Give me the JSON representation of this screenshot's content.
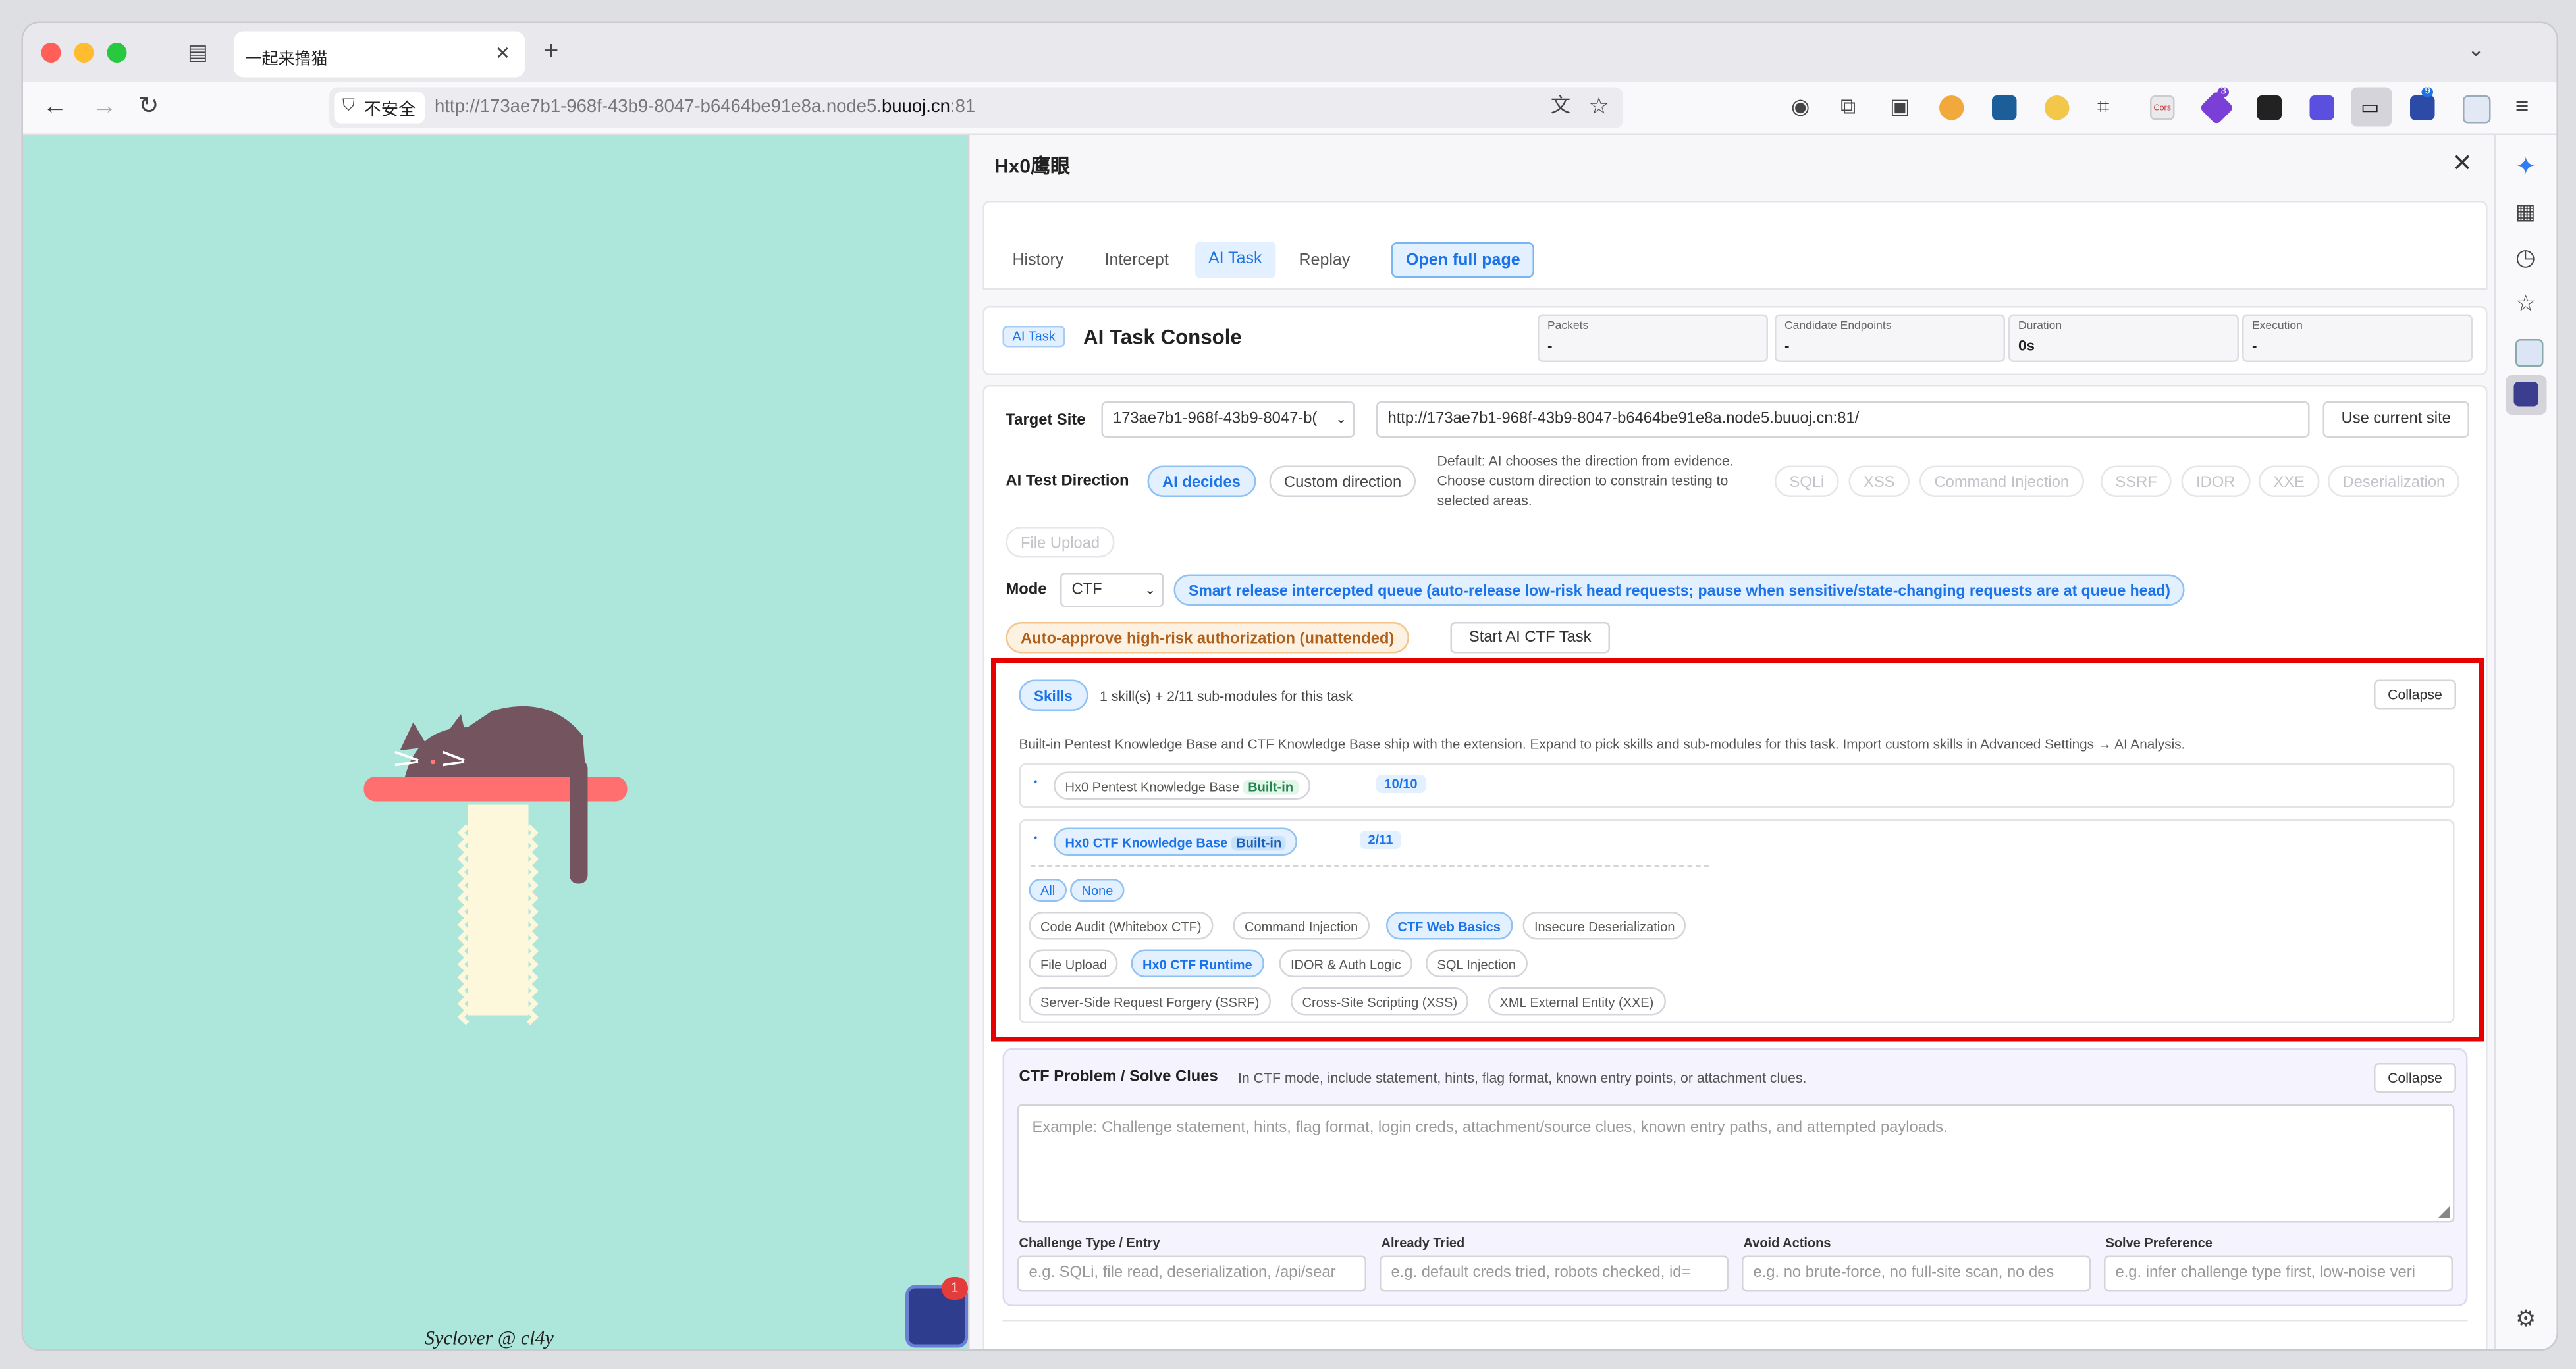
{
  "browser": {
    "tab_title": "一起来撸猫",
    "security_label": "不安全",
    "url_prefix": "http://173ae7b1-968f-43b9-8047-b6464be91e8a.node5.",
    "url_domain": "buuoj.cn",
    "url_suffix": ":81",
    "ext_badge_1": "3",
    "ext_badge_2": "9",
    "ext_label": "Cors",
    "colors": {
      "traffic_red": "#ff5f57",
      "traffic_yellow": "#febc2e",
      "traffic_green": "#28c840"
    }
  },
  "page": {
    "bg_color": "#ade6da",
    "credit": "Syclover @ cl4y",
    "notification_badge": "1"
  },
  "panel": {
    "title": "Hx0鹰眼",
    "tabs": [
      "History",
      "Intercept",
      "AI Task",
      "Replay"
    ],
    "active_tab": "AI Task",
    "open_full_page": "Open full page",
    "console": {
      "badge": "AI Task",
      "title": "AI Task Console",
      "stats": [
        {
          "label": "Packets",
          "value": "-"
        },
        {
          "label": "Candidate Endpoints",
          "value": "-"
        },
        {
          "label": "Duration",
          "value": "0s"
        },
        {
          "label": "Execution",
          "value": "-"
        }
      ]
    },
    "target": {
      "label": "Target Site",
      "select_value": "173ae7b1-968f-43b9-8047-b(",
      "url": "http://173ae7b1-968f-43b9-8047-b6464be91e8a.node5.buuoj.cn:81/",
      "use_current": "Use current site"
    },
    "direction": {
      "label": "AI Test Direction",
      "ai_decides": "AI decides",
      "custom": "Custom direction",
      "description": "Default: AI chooses the direction from evidence. Choose custom direction to constrain testing to selected areas.",
      "options": [
        "SQLi",
        "XSS",
        "Command Injection",
        "SSRF",
        "IDOR",
        "XXE",
        "Deserialization",
        "File Upload"
      ]
    },
    "mode": {
      "label": "Mode",
      "value": "CTF",
      "smart_release": "Smart release intercepted queue (auto-release low-risk head requests; pause when sensitive/state-changing requests are at queue head)",
      "auto_approve": "Auto-approve high-risk authorization (unattended)",
      "start_button": "Start AI CTF Task"
    },
    "skills": {
      "badge": "Skills",
      "summary": "1 skill(s) + 2/11 sub-modules for this task",
      "collapse": "Collapse",
      "description": "Built-in Pentest Knowledge Base and CTF Knowledge Base ship with the extension. Expand to pick skills and sub-modules for this task. Import custom skills in Advanced Settings → AI Analysis.",
      "kb_pentest": {
        "name": "Hx0 Pentest Knowledge Base",
        "builtin": "Built-in",
        "count": "10/10"
      },
      "kb_ctf": {
        "name": "Hx0 CTF Knowledge Base",
        "builtin": "Built-in",
        "count": "2/11"
      },
      "all": "All",
      "none": "None",
      "modules": [
        {
          "name": "Code Audit (Whitebox CTF)",
          "on": false
        },
        {
          "name": "Command Injection",
          "on": false
        },
        {
          "name": "CTF Web Basics",
          "on": true
        },
        {
          "name": "Insecure Deserialization",
          "on": false
        },
        {
          "name": "File Upload",
          "on": false
        },
        {
          "name": "Hx0 CTF Runtime",
          "on": true
        },
        {
          "name": "IDOR & Auth Logic",
          "on": false
        },
        {
          "name": "SQL Injection",
          "on": false
        },
        {
          "name": "Server-Side Request Forgery (SSRF)",
          "on": false
        },
        {
          "name": "Cross-Site Scripting (XSS)",
          "on": false
        },
        {
          "name": "XML External Entity (XXE)",
          "on": false
        }
      ],
      "highlight_color": "#e60000"
    },
    "ctf": {
      "title": "CTF Problem / Solve Clues",
      "hint": "In CTF mode, include statement, hints, flag format, known entry points, or attachment clues.",
      "collapse": "Collapse",
      "placeholder": "Example: Challenge statement, hints, flag format, login creds, attachment/source clues, known entry paths, and attempted payloads.",
      "fields": [
        {
          "label": "Challenge Type / Entry",
          "placeholder": "e.g. SQLi, file read, deserialization, /api/sear"
        },
        {
          "label": "Already Tried",
          "placeholder": "e.g. default creds tried, robots checked, id="
        },
        {
          "label": "Avoid Actions",
          "placeholder": "e.g. no brute-force, no full-site scan, no des"
        },
        {
          "label": "Solve Preference",
          "placeholder": "e.g. infer challenge type first, low-noise veri"
        }
      ]
    }
  }
}
